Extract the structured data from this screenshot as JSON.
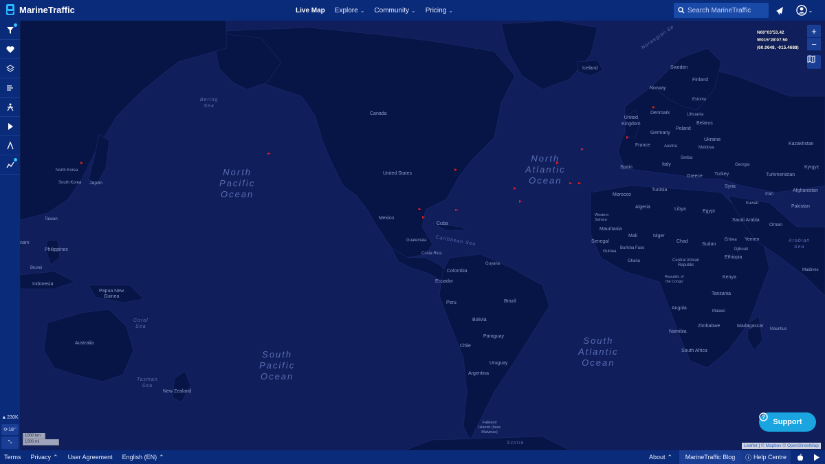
{
  "header": {
    "logo_text": "MarineTraffic",
    "nav": [
      {
        "label": "Live Map",
        "active": true,
        "has_menu": false
      },
      {
        "label": "Explore",
        "active": false,
        "has_menu": true
      },
      {
        "label": "Community",
        "active": false,
        "has_menu": true
      },
      {
        "label": "Pricing",
        "active": false,
        "has_menu": true
      }
    ],
    "search_placeholder": "Search MarineTraffic"
  },
  "sidebar": {
    "items": [
      "filter-icon",
      "heart-icon",
      "layers-icon",
      "weather-icon",
      "density-icon",
      "play-icon",
      "measure-icon",
      "analytics-icon"
    ],
    "vessel_count": "230K",
    "timer": "18"
  },
  "map": {
    "coords": {
      "lat": "N60°03'53.42",
      "lon": "W015°28'07.50",
      "decimal": "(60.0648, -015.4688)"
    },
    "scale": {
      "km": "1000 km",
      "mi": "1000 mi"
    },
    "attribution": {
      "leaflet": "Leaflet",
      "mapbox": "© Mapbox",
      "osm": "© OpenStreetMap"
    },
    "oceans": [
      {
        "name": "North\nPacific\nOcean"
      },
      {
        "name": "North\nAtlantic\nOcean"
      },
      {
        "name": "South\nPacific\nOcean"
      },
      {
        "name": "South\nAtlantic\nOcean"
      }
    ],
    "seas": [
      "Bering\nSea",
      "Caribbean Sea",
      "Coral\nSea",
      "Tasman\nSea",
      "Arabian\nSea",
      "Norwegian Se",
      "Scotia"
    ],
    "labels": [
      "Iceland",
      "Sweden",
      "Finland",
      "Norway",
      "Estonia",
      "Lithuania",
      "United\nKingdom",
      "Denmark",
      "Belarus",
      "Poland",
      "Germany",
      "Ukraine",
      "France",
      "Austria",
      "Moldova",
      "Kazakhstan",
      "Serbia",
      "Italy",
      "Georgia",
      "Kyrgyz",
      "Spain",
      "Greece",
      "Turkey",
      "Turkmenistan",
      "Tunisia",
      "Syria",
      "Afghanistan",
      "Morocco",
      "Iran",
      "Kuwait",
      "Pakistan",
      "Algeria",
      "Libya",
      "Egypt",
      "Western\nSahara",
      "Saudi Arabia",
      "Oman",
      "Mauritania",
      "Mali",
      "Niger",
      "Chad",
      "Sudan",
      "Eritrea",
      "Yemen",
      "Senegal",
      "Burkina Faso",
      "Djibouti",
      "Guinea",
      "Ghana",
      "Central African\nRepublic",
      "Ethiopia",
      "Republic of\nthe Congo",
      "Kenya",
      "Maldives",
      "Tanzania",
      "Angola",
      "Malawi",
      "Zimbabwe",
      "Madagascar",
      "Mauritius",
      "Namibia",
      "South Africa",
      "Canada",
      "United States",
      "Mexico",
      "Cuba",
      "Guatemala",
      "Costa Rica",
      "Guyana",
      "Colombia",
      "Ecuador",
      "Peru",
      "Brazil",
      "Bolivia",
      "Paraguay",
      "Chile",
      "Uruguay",
      "Argentina",
      "Falkland\nIslands (Islas\nMalvinas)",
      "North Korea",
      "South Korea",
      "Japan",
      "Taiwan",
      "Philippines",
      "nam",
      "Brunei",
      "Indonesia",
      "Papua New\nGuinea",
      "Australia",
      "New Zealand"
    ]
  },
  "support_label": "Support",
  "footer": {
    "left": [
      {
        "label": "Terms",
        "menu": false
      },
      {
        "label": "Privacy",
        "menu": true
      },
      {
        "label": "User Agreement",
        "menu": false
      },
      {
        "label": "English (EN)",
        "menu": true
      }
    ],
    "about": "About",
    "blog": "MarineTraffic Blog",
    "help": "Help Centre"
  },
  "colors": {
    "header": "#0a2a7a",
    "ocean": "#101f5c",
    "land": "#061446",
    "vessel": "#e0201c",
    "accent": "#1aa4e0"
  }
}
